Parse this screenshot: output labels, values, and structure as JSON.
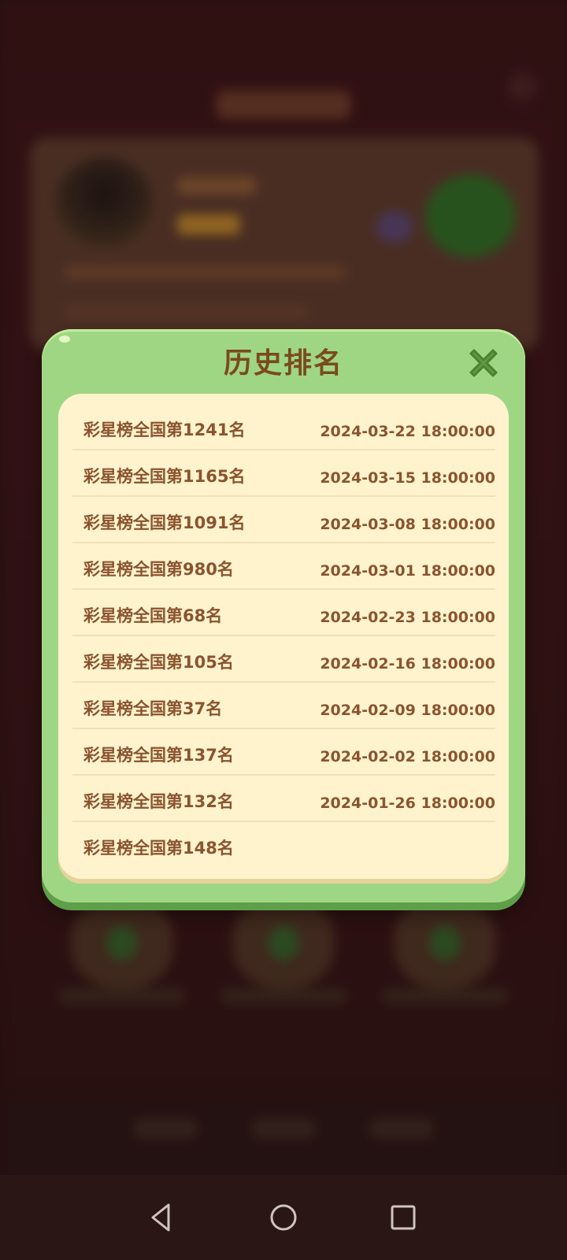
{
  "modal": {
    "title": "历史排名",
    "rows": [
      {
        "rank": "彩星榜全国第1241名",
        "date": "2024-03-22 18:00:00"
      },
      {
        "rank": "彩星榜全国第1165名",
        "date": "2024-03-15 18:00:00"
      },
      {
        "rank": "彩星榜全国第1091名",
        "date": "2024-03-08 18:00:00"
      },
      {
        "rank": "彩星榜全国第980名",
        "date": "2024-03-01 18:00:00"
      },
      {
        "rank": "彩星榜全国第68名",
        "date": "2024-02-23 18:00:00"
      },
      {
        "rank": "彩星榜全国第105名",
        "date": "2024-02-16 18:00:00"
      },
      {
        "rank": "彩星榜全国第37名",
        "date": "2024-02-09 18:00:00"
      },
      {
        "rank": "彩星榜全国第137名",
        "date": "2024-02-02 18:00:00"
      },
      {
        "rank": "彩星榜全国第132名",
        "date": "2024-01-26 18:00:00"
      },
      {
        "rank": "彩星榜全国第148名",
        "date": ""
      }
    ]
  },
  "icons": {
    "close": "close-icon",
    "back": "back-icon",
    "home": "home-icon",
    "recents": "recents-icon"
  },
  "colors": {
    "modal_green": "#9fd684",
    "panel_cream": "#fef3cd",
    "text_brown": "#8a5430",
    "title_brown": "#7a4a1f",
    "close_green": "#5f9a40"
  }
}
